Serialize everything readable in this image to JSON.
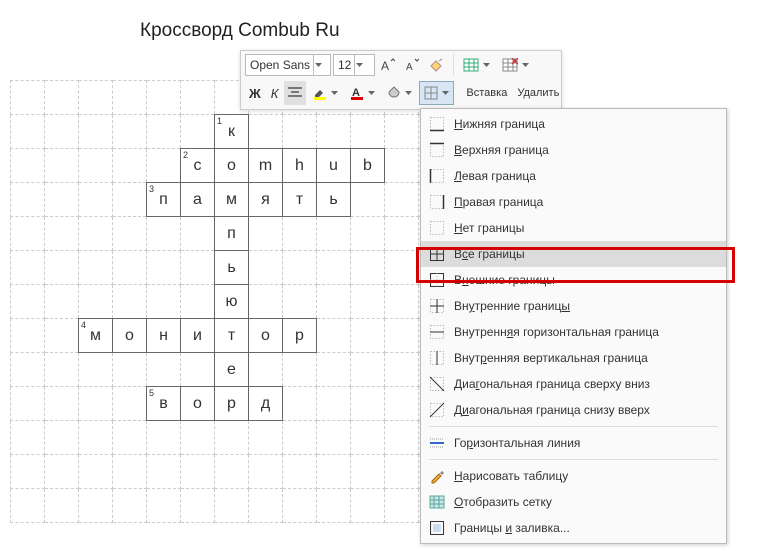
{
  "title": "Кроссворд Combub Ru",
  "toolbar": {
    "font": "Open Sans",
    "size": "12",
    "bold": "Ж",
    "italic": "К",
    "insert": "Вставка",
    "delete": "Удалить"
  },
  "grid": {
    "cols": 13,
    "rows": 13,
    "cells": [
      {
        "r": 1,
        "c": 6,
        "ch": "к",
        "num": "1",
        "b": true
      },
      {
        "r": 2,
        "c": 5,
        "ch": "с",
        "num": "2",
        "b": true
      },
      {
        "r": 2,
        "c": 6,
        "ch": "о",
        "b": true
      },
      {
        "r": 2,
        "c": 7,
        "ch": "m",
        "b": true
      },
      {
        "r": 2,
        "c": 8,
        "ch": "h",
        "b": true
      },
      {
        "r": 2,
        "c": 9,
        "ch": "u",
        "b": true
      },
      {
        "r": 2,
        "c": 10,
        "ch": "b",
        "b": true
      },
      {
        "r": 3,
        "c": 4,
        "ch": "п",
        "num": "3",
        "b": true
      },
      {
        "r": 3,
        "c": 5,
        "ch": "а",
        "b": true
      },
      {
        "r": 3,
        "c": 6,
        "ch": "м",
        "b": true
      },
      {
        "r": 3,
        "c": 7,
        "ch": "я",
        "b": true
      },
      {
        "r": 3,
        "c": 8,
        "ch": "т",
        "b": true
      },
      {
        "r": 3,
        "c": 9,
        "ch": "ь",
        "b": true
      },
      {
        "r": 4,
        "c": 6,
        "ch": "п",
        "b": true
      },
      {
        "r": 5,
        "c": 6,
        "ch": "ь",
        "b": true
      },
      {
        "r": 6,
        "c": 6,
        "ch": "ю",
        "b": true
      },
      {
        "r": 7,
        "c": 2,
        "ch": "м",
        "num": "4",
        "b": true
      },
      {
        "r": 7,
        "c": 3,
        "ch": "о",
        "b": true
      },
      {
        "r": 7,
        "c": 4,
        "ch": "н",
        "b": true
      },
      {
        "r": 7,
        "c": 5,
        "ch": "и",
        "b": true
      },
      {
        "r": 7,
        "c": 6,
        "ch": "т",
        "b": true
      },
      {
        "r": 7,
        "c": 7,
        "ch": "о",
        "b": true
      },
      {
        "r": 7,
        "c": 8,
        "ch": "р",
        "b": true
      },
      {
        "r": 8,
        "c": 6,
        "ch": "е",
        "b": true
      },
      {
        "r": 9,
        "c": 4,
        "ch": "в",
        "num": "5",
        "b": true
      },
      {
        "r": 9,
        "c": 5,
        "ch": "о",
        "b": true
      },
      {
        "r": 9,
        "c": 6,
        "ch": "р",
        "b": true
      },
      {
        "r": 9,
        "c": 7,
        "ch": "д",
        "b": true
      }
    ]
  },
  "menu": [
    {
      "k": "bottom",
      "t": "<u>Н</u>ижняя граница",
      "ic": "bb"
    },
    {
      "k": "top",
      "t": "<u>В</u>ерхняя граница",
      "ic": "bt"
    },
    {
      "k": "left",
      "t": "<u>Л</u>евая граница",
      "ic": "bl"
    },
    {
      "k": "right",
      "t": "<u>П</u>равая граница",
      "ic": "br"
    },
    {
      "k": "none",
      "t": "<u>Н</u>ет границы",
      "ic": "bn"
    },
    {
      "k": "all",
      "t": "В<u>с</u>е границы",
      "ic": "ba",
      "sel": true
    },
    {
      "k": "outer",
      "t": "В<u>н</u>ешние границы",
      "ic": "bo"
    },
    {
      "k": "inner",
      "t": "Вн<u>у</u>тренние границ<u>ы</u>",
      "ic": "bi"
    },
    {
      "k": "ih",
      "t": "Внутренн<u>я</u>я горизонтальная граница",
      "ic": "bih"
    },
    {
      "k": "iv",
      "t": "Внут<u>р</u>енняя вертикальная граница",
      "ic": "biv"
    },
    {
      "k": "dd",
      "t": "Диа<u>г</u>ональная граница сверху вниз",
      "ic": "bdd"
    },
    {
      "k": "du",
      "t": "Д<u>и</u>агональная граница снизу вверх",
      "ic": "bdu"
    },
    {
      "sep": true
    },
    {
      "k": "hline",
      "t": "Го<u>р</u>изонтальная линия",
      "ic": "hl"
    },
    {
      "sep": true
    },
    {
      "k": "draw",
      "t": "<u>Н</u>арисовать таблицу",
      "ic": "pen"
    },
    {
      "k": "gridv",
      "t": "<u>О</u>тобразить сетку",
      "ic": "gr"
    },
    {
      "k": "bf",
      "t": "Границы <u>и</u> заливка...",
      "ic": "bf"
    }
  ]
}
